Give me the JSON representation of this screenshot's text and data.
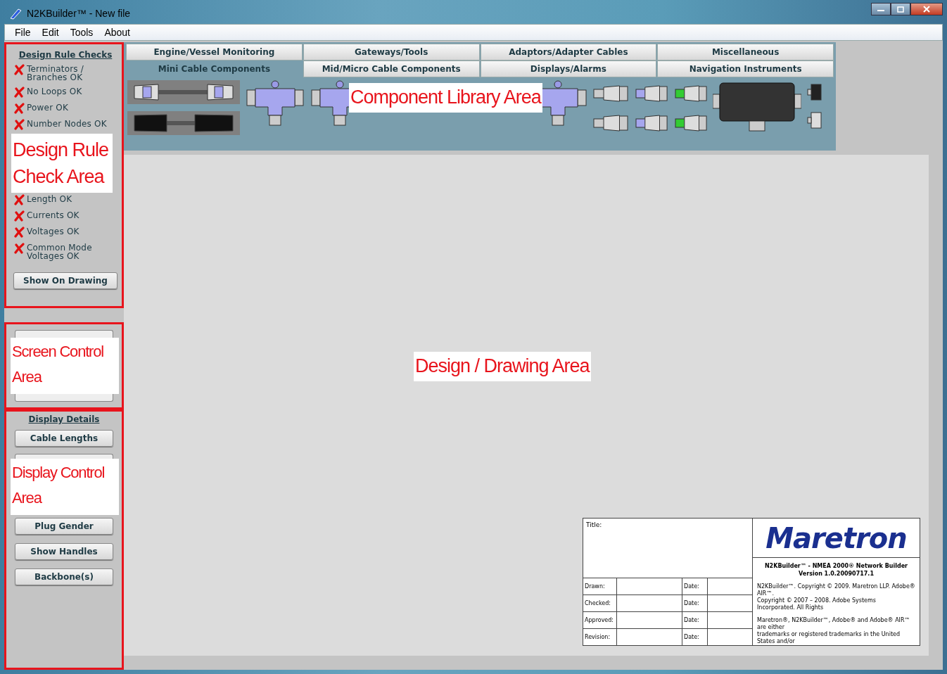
{
  "window": {
    "title": "N2KBuilder™ - New file"
  },
  "menu": [
    "File",
    "Edit",
    "Tools",
    "About"
  ],
  "design_rule_checks": {
    "heading": "Design Rule Checks",
    "annotation": "Design Rule\nCheck Area",
    "checks_before": [
      {
        "label": "Terminators /\nBranches OK",
        "passed": false
      },
      {
        "label": "No Loops OK",
        "passed": false
      },
      {
        "label": "Power OK",
        "passed": false
      },
      {
        "label": "Number Nodes OK",
        "passed": false
      }
    ],
    "checks_after": [
      {
        "label": "Length OK",
        "passed": false
      },
      {
        "label": "Currents OK",
        "passed": false
      },
      {
        "label": "Voltages OK",
        "passed": false
      },
      {
        "label": "Common Mode\nVoltages OK",
        "passed": false
      }
    ],
    "button": "Show On Drawing"
  },
  "screen_control": {
    "annotation": "Screen Control\nArea"
  },
  "display_control": {
    "heading": "Display Details",
    "annotation": "Display Control\nArea",
    "buttons_before": [
      "Cable Lengths"
    ],
    "buttons_after": [
      "Plug Gender",
      "Show Handles",
      "Backbone(s)"
    ]
  },
  "component_library": {
    "annotation": "Component Library Area",
    "tab_rows": [
      [
        {
          "label": "Engine/Vessel Monitoring",
          "selected": false
        },
        {
          "label": "Gateways/Tools",
          "selected": false
        },
        {
          "label": "Adaptors/Adapter Cables",
          "selected": false
        },
        {
          "label": "Miscellaneous",
          "selected": false
        }
      ],
      [
        {
          "label": "Mini Cable Components",
          "selected": true
        },
        {
          "label": "Mid/Micro Cable Components",
          "selected": false
        },
        {
          "label": "Displays/Alarms",
          "selected": false
        },
        {
          "label": "Navigation Instruments",
          "selected": false
        }
      ]
    ]
  },
  "drawing_area": {
    "annotation": "Design / Drawing Area",
    "title_block": {
      "title_label": "Title:",
      "logo": "Maretron",
      "rows": [
        {
          "label": "Drawn:",
          "date_label": "Date:"
        },
        {
          "label": "Checked:",
          "date_label": "Date:"
        },
        {
          "label": "Approved:",
          "date_label": "Date:"
        },
        {
          "label": "Revision:",
          "date_label": "Date:"
        }
      ],
      "product": "N2KBuilder™ - NMEA 2000® Network Builder",
      "version": "Version 1.0.20090717.1",
      "notes": [
        "N2KBuilder™. Copyright © 2009. Maretron LLP. Adobe® AIR™.\nCopyright © 2007 – 2008. Adobe Systems Incorporated. All Rights",
        "Maretron®, N2KBuilder™, Adobe® and Adobe® AIR™ are either\ntrademarks or registered trademarks in the United States and/or"
      ]
    }
  }
}
